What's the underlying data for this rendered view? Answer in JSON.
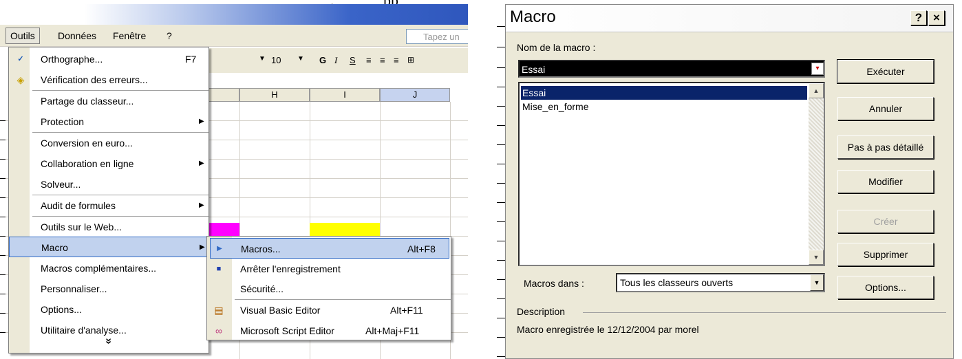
{
  "left": {
    "top_fragment": ",             pp",
    "menubar": {
      "items": [
        "Outils",
        "Données",
        "Fenêtre",
        "?"
      ],
      "ask_placeholder": "Tapez un"
    },
    "format_toolbar": {
      "font_size": "10",
      "bold": "G",
      "italic": "I",
      "underline": "S"
    },
    "columns": [
      "H",
      "I",
      "J"
    ],
    "tools_menu": {
      "items": [
        {
          "label": "Orthographe...",
          "shortcut": "F7",
          "icon": "spellcheck-icon"
        },
        {
          "label": "Vérification des erreurs...",
          "icon": "error-check-icon"
        },
        {
          "label": "Partage du classeur..."
        },
        {
          "label": "Protection",
          "submenu": true
        },
        {
          "label": "Conversion en euro..."
        },
        {
          "label": "Collaboration en ligne",
          "submenu": true
        },
        {
          "label": "Solveur..."
        },
        {
          "label": "Audit de formules",
          "submenu": true
        },
        {
          "label": "Outils sur le Web..."
        },
        {
          "label": "Macro",
          "submenu": true,
          "highlighted": true
        },
        {
          "label": "Macros complémentaires..."
        },
        {
          "label": "Personnaliser..."
        },
        {
          "label": "Options..."
        },
        {
          "label": "Utilitaire d'analyse..."
        }
      ],
      "more_glyph": "»"
    },
    "macro_submenu": {
      "items": [
        {
          "label": "Macros...",
          "shortcut": "Alt+F8",
          "icon": "play-icon",
          "highlighted": true
        },
        {
          "label": "Arrêter l'enregistrement",
          "icon": "stop-icon"
        },
        {
          "label": "Sécurité..."
        },
        {
          "label": "Visual Basic Editor",
          "shortcut": "Alt+F11",
          "icon": "vb-editor-icon"
        },
        {
          "label": "Microsoft Script Editor",
          "shortcut": "Alt+Maj+F11",
          "icon": "script-editor-icon"
        }
      ]
    },
    "colors": {
      "magenta": "#ff00ff",
      "yellow": "#ffff00",
      "highlight": "#c1d2ee"
    }
  },
  "dialog": {
    "title": "Macro",
    "help_button": "?",
    "close_button": "×",
    "name_label": "Nom de la macro :",
    "name_value": "Essai",
    "macros": [
      "Essai",
      "Mise_en_forme"
    ],
    "selected_macro": "Essai",
    "macros_in_label": "Macros dans :",
    "macros_in_value": "Tous les classeurs ouverts",
    "description_label": "Description",
    "description_text": "Macro enregistrée le 12/12/2004 par morel",
    "buttons": {
      "run": "Exécuter",
      "cancel": "Annuler",
      "step": "Pas à pas détaillé",
      "edit": "Modifier",
      "create": "Créer",
      "delete": "Supprimer",
      "options": "Options..."
    }
  }
}
